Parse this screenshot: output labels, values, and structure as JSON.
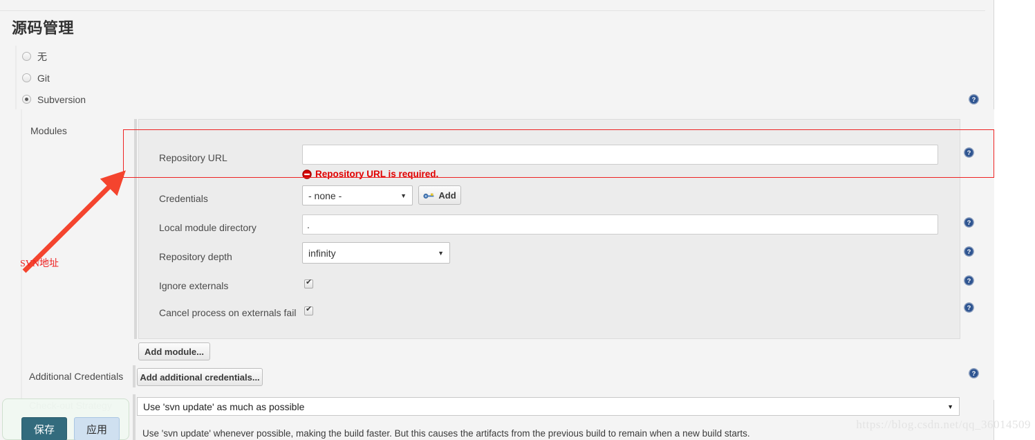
{
  "page": {
    "title": "源码管理",
    "watermark": "https://blog.csdn.net/qq_36014509"
  },
  "scm_radios": [
    {
      "label": "无",
      "selected": false
    },
    {
      "label": "Git",
      "selected": false
    },
    {
      "label": "Subversion",
      "selected": true
    }
  ],
  "modules": {
    "label": "Modules",
    "add_module_button": "Add module...",
    "fields": {
      "repository_url": {
        "label": "Repository URL",
        "value": "",
        "error": "Repository URL is required.",
        "error_icon": "error-circle-icon"
      },
      "credentials": {
        "label": "Credentials",
        "selected": "- none -",
        "add_button": "Add",
        "add_icon": "key-icon"
      },
      "local_module_directory": {
        "label": "Local module directory",
        "value": "."
      },
      "repository_depth": {
        "label": "Repository depth",
        "selected": "infinity"
      },
      "ignore_externals": {
        "label": "Ignore externals",
        "checked": true
      },
      "cancel_process_on_externals_fail": {
        "label": "Cancel process on externals fail",
        "checked": true
      }
    }
  },
  "additional_credentials": {
    "label": "Additional Credentials",
    "button": "Add additional credentials..."
  },
  "checkout_strategy": {
    "label": "Check-out Strategy",
    "selected": "Use 'svn update' as much as possible",
    "description": "Use 'svn update' whenever possible, making the build faster. But this causes the artifacts from the previous build to remain when a new build starts."
  },
  "annotation": {
    "text": "SVN地址",
    "color": "#ee2222"
  },
  "form_actions": {
    "save": "保存",
    "apply": "应用"
  },
  "icons": {
    "help": "help-icon",
    "caret_down": "▼"
  },
  "colors": {
    "accent_save": "#336b7d",
    "accent_apply": "#cfe0f0",
    "error": "#e00000",
    "annotation": "#ee2222",
    "help_icon": "#2f5591"
  }
}
